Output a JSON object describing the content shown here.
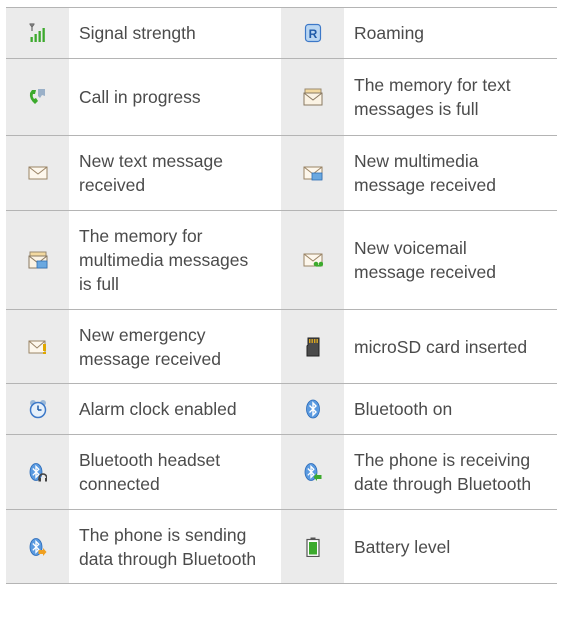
{
  "rows": [
    {
      "left": {
        "icon": "signal-strength-icon",
        "lines": [
          "Signal strength"
        ]
      },
      "right": {
        "icon": "roaming-icon",
        "lines": [
          "Roaming"
        ]
      }
    },
    {
      "left": {
        "icon": "call-in-progress-icon",
        "lines": [
          "Call in progress"
        ]
      },
      "right": {
        "icon": "text-memory-full-icon",
        "lines": [
          "The memory for text",
          "messages is full"
        ]
      }
    },
    {
      "left": {
        "icon": "new-text-message-icon",
        "lines": [
          "New text message",
          "received"
        ]
      },
      "right": {
        "icon": "new-multimedia-message-icon",
        "lines": [
          "New multimedia",
          "message received"
        ]
      }
    },
    {
      "left": {
        "icon": "multimedia-memory-full-icon",
        "lines": [
          "The memory for",
          "multimedia messages",
          "is full"
        ]
      },
      "right": {
        "icon": "new-voicemail-icon",
        "lines": [
          "New voicemail",
          "message received"
        ]
      }
    },
    {
      "left": {
        "icon": "emergency-message-icon",
        "lines": [
          "New emergency",
          "message received"
        ]
      },
      "right": {
        "icon": "microsd-card-icon",
        "lines": [
          "microSD card inserted"
        ]
      }
    },
    {
      "left": {
        "icon": "alarm-clock-icon",
        "lines": [
          "Alarm clock enabled"
        ]
      },
      "right": {
        "icon": "bluetooth-on-icon",
        "lines": [
          "Bluetooth on"
        ]
      }
    },
    {
      "left": {
        "icon": "bluetooth-headset-icon",
        "lines": [
          "Bluetooth headset",
          "connected"
        ]
      },
      "right": {
        "icon": "bluetooth-receiving-icon",
        "lines": [
          "The phone is receiving",
          "date through Bluetooth"
        ]
      }
    },
    {
      "left": {
        "icon": "bluetooth-sending-icon",
        "lines": [
          "The phone is sending",
          "data through Bluetooth"
        ]
      },
      "right": {
        "icon": "battery-level-icon",
        "lines": [
          "Battery level"
        ]
      }
    }
  ]
}
